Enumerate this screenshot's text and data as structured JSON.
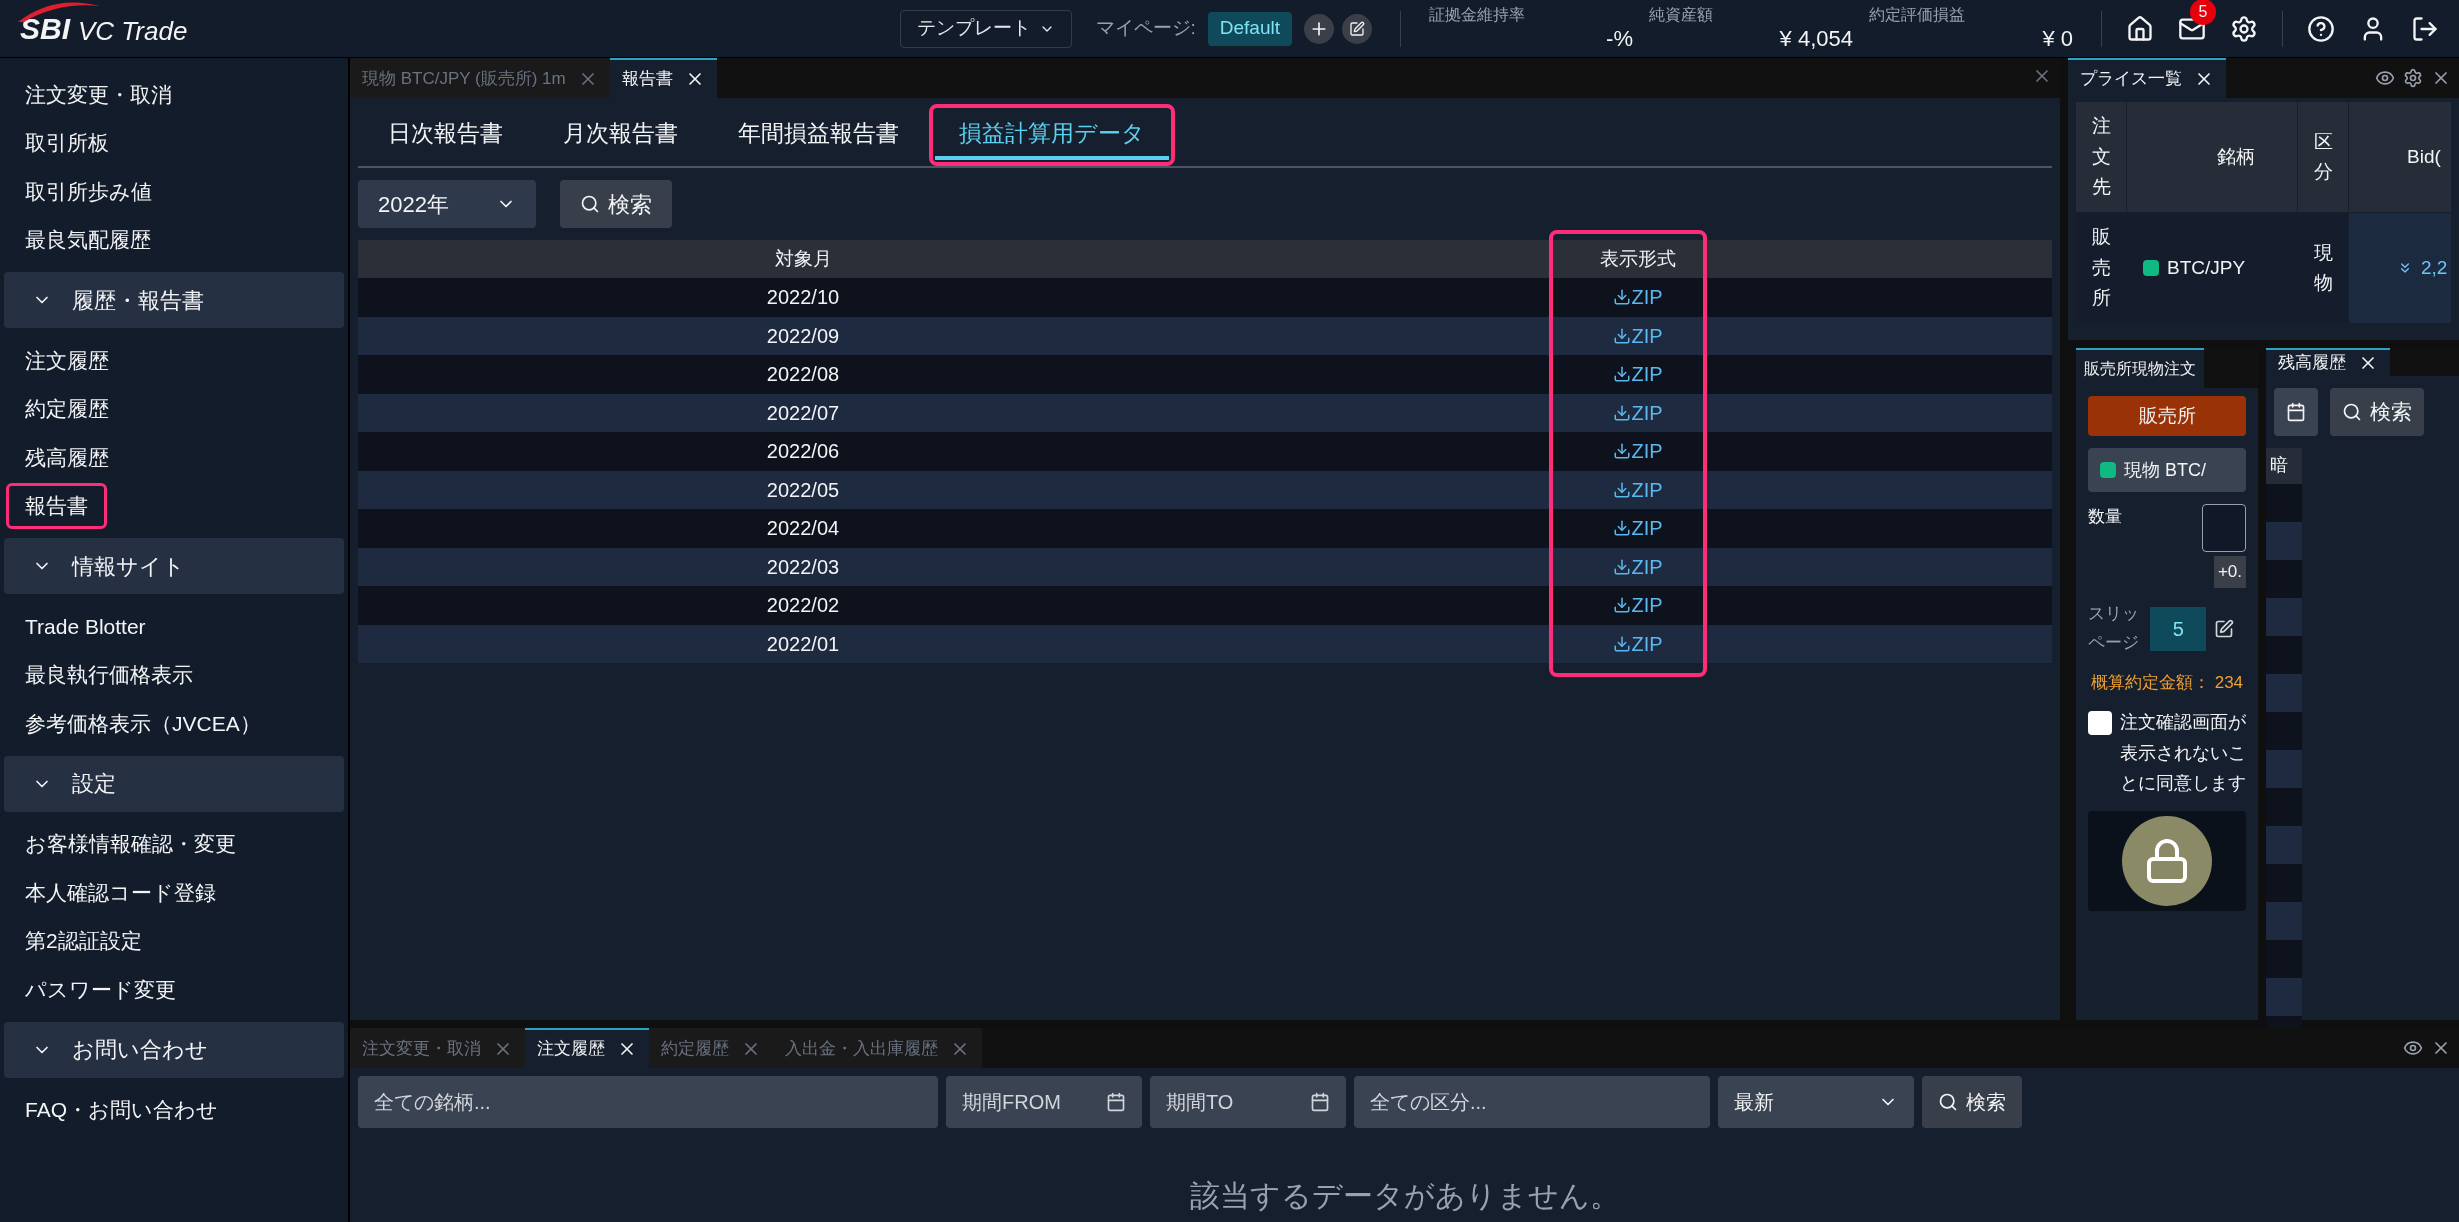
{
  "header": {
    "logo_mark": "SBI",
    "logo_text": "VC Trade",
    "template_button": "テンプレート",
    "mypage_label": "マイページ:",
    "mypage_value": "Default",
    "stats": [
      {
        "label": "証拠金維持率",
        "value": "-%"
      },
      {
        "label": "純資産額",
        "value": "¥ 4,054"
      },
      {
        "label": "約定評価損益",
        "value": "¥ 0"
      }
    ],
    "mail_badge": "5"
  },
  "sidebar": {
    "sections": [
      {
        "items": [
          {
            "label": "注文変更・取消",
            "selected": false
          },
          {
            "label": "取引所板",
            "selected": false
          },
          {
            "label": "取引所歩み値",
            "selected": false
          },
          {
            "label": "最良気配履歴",
            "selected": false
          }
        ]
      },
      {
        "title": "履歴・報告書",
        "items": [
          {
            "label": "注文履歴",
            "selected": false
          },
          {
            "label": "約定履歴",
            "selected": false
          },
          {
            "label": "残高履歴",
            "selected": false
          },
          {
            "label": "報告書",
            "selected": true
          }
        ]
      },
      {
        "title": "情報サイト",
        "items": [
          {
            "label": "Trade Blotter",
            "selected": false
          },
          {
            "label": "最良執行価格表示",
            "selected": false
          },
          {
            "label": "参考価格表示（JVCEA）",
            "selected": false
          }
        ]
      },
      {
        "title": "設定",
        "items": [
          {
            "label": "お客様情報確認・変更",
            "selected": false
          },
          {
            "label": "本人確認コード登録",
            "selected": false
          },
          {
            "label": "第2認証設定",
            "selected": false
          },
          {
            "label": "パスワード変更",
            "selected": false
          }
        ]
      },
      {
        "title": "お問い合わせ",
        "items": [
          {
            "label": "FAQ・お問い合わせ",
            "selected": false
          }
        ]
      }
    ]
  },
  "main_panel": {
    "tabs": [
      {
        "label": "現物 BTC/JPY (販売所) 1m",
        "selected": false
      },
      {
        "label": "報告書",
        "selected": true
      }
    ],
    "report_tabs": [
      {
        "label": "日次報告書",
        "selected": false
      },
      {
        "label": "月次報告書",
        "selected": false
      },
      {
        "label": "年間損益報告書",
        "selected": false
      },
      {
        "label": "損益計算用データ",
        "selected": true
      }
    ],
    "year_select": "2022年",
    "search_button": "検索",
    "table": {
      "columns": [
        "対象月",
        "表示形式"
      ],
      "highlight_column": true,
      "rows": [
        {
          "month": "2022/10",
          "format": "ZIP"
        },
        {
          "month": "2022/09",
          "format": "ZIP"
        },
        {
          "month": "2022/08",
          "format": "ZIP"
        },
        {
          "month": "2022/07",
          "format": "ZIP"
        },
        {
          "month": "2022/06",
          "format": "ZIP"
        },
        {
          "month": "2022/05",
          "format": "ZIP"
        },
        {
          "month": "2022/04",
          "format": "ZIP"
        },
        {
          "month": "2022/03",
          "format": "ZIP"
        },
        {
          "month": "2022/02",
          "format": "ZIP"
        },
        {
          "month": "2022/01",
          "format": "ZIP"
        }
      ]
    }
  },
  "price_panel": {
    "tab": "プライス一覧",
    "columns": [
      "注文先",
      "銘柄",
      "区分",
      "Bid("
    ],
    "rows": [
      {
        "venue": "販売所",
        "symbol": "BTC/JPY",
        "color": "#10b981",
        "type": "現物",
        "bid": "2,2"
      }
    ]
  },
  "order_panel": {
    "tab": "販売所現物注文",
    "venue_button": "販売所",
    "symbol": {
      "label": "現物 BTC/",
      "color": "#10b981"
    },
    "quantity_label": "数量",
    "step_button": "+0.",
    "slippage_label": "スリッページ",
    "slippage_value": "5",
    "estimate_label": "概算約定金額：",
    "estimate_value": "234",
    "confirm_checkbox": {
      "label": "注文確認画面が表示されないことに同意します",
      "checked": false
    }
  },
  "balance_panel": {
    "tab": "残高履歴",
    "search_button": "検索",
    "column": "暗"
  },
  "bottom_panel": {
    "tabs": [
      {
        "label": "注文変更・取消",
        "selected": false
      },
      {
        "label": "注文履歴",
        "selected": true
      },
      {
        "label": "約定履歴",
        "selected": false
      },
      {
        "label": "入出金・入出庫履歴",
        "selected": false
      }
    ],
    "symbol_placeholder": "全ての銘柄...",
    "from_placeholder": "期間FROM",
    "to_placeholder": "期間TO",
    "type_placeholder": "全ての区分...",
    "sort_select": "最新",
    "search_button": "検索",
    "empty_message": "該当するデータがありません。"
  }
}
